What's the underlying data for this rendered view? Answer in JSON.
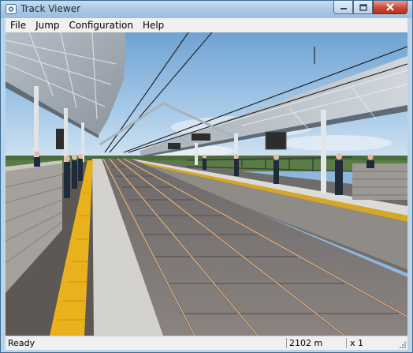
{
  "window": {
    "title": "Track Viewer",
    "minimize_icon": "minimize-icon",
    "maximize_icon": "maximize-icon",
    "close_icon": "close-icon"
  },
  "menu": {
    "items": [
      {
        "label": "File"
      },
      {
        "label": "Jump"
      },
      {
        "label": "Configuration"
      },
      {
        "label": "Help"
      }
    ]
  },
  "status": {
    "state": "Ready",
    "distance": "2102 m",
    "speed_factor": "x 1"
  },
  "scene": {
    "sky_color": "#8ab7df",
    "roof_color": "#9aa4ad",
    "tactile_strip_color": "#e9b21d",
    "rail_color": "#8b6a4f"
  }
}
